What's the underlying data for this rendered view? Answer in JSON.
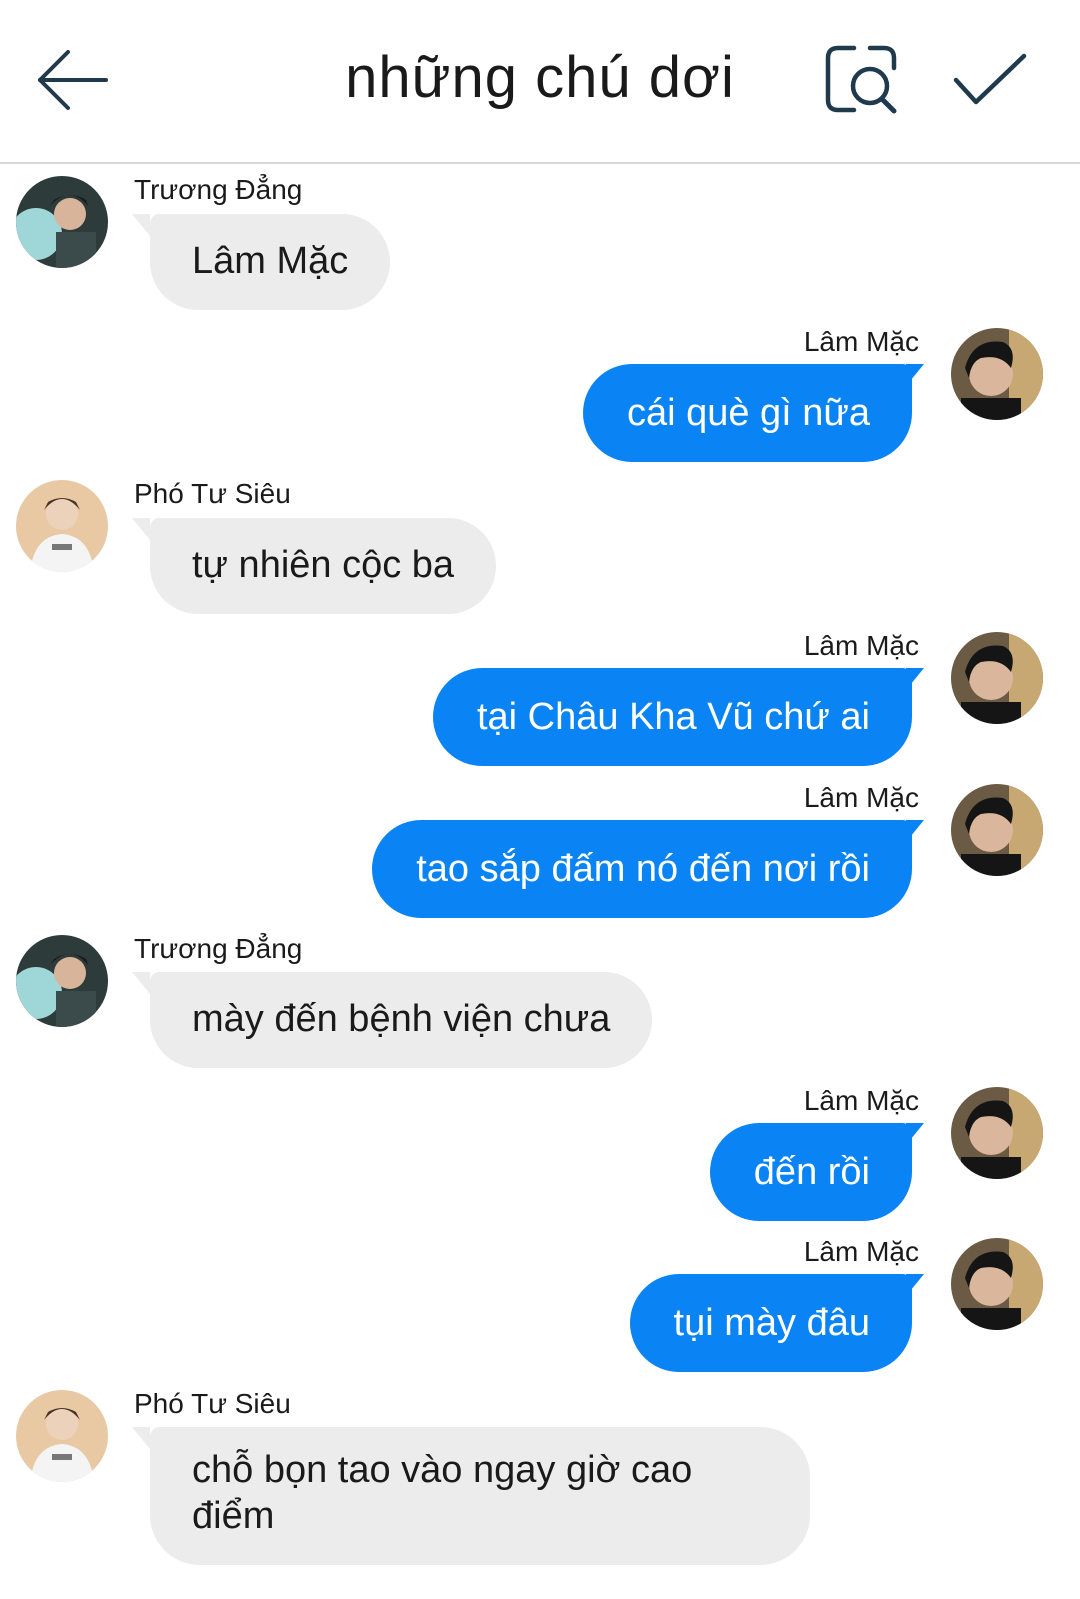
{
  "header": {
    "title": "những chú dơi",
    "back_icon": "arrow-left-icon",
    "search_icon": "search-chat-icon",
    "confirm_icon": "checkmark-icon"
  },
  "colors": {
    "outgoing_bubble": "#0a84f4",
    "incoming_bubble": "#ececec"
  },
  "messages": [
    {
      "sender": "Trương Đẳng",
      "text": "Lâm Mặc",
      "direction": "in"
    },
    {
      "sender": "Lâm Mặc",
      "text": "cái què gì nữa",
      "direction": "out"
    },
    {
      "sender": "Phó Tư Siêu",
      "text": "tự nhiên cộc ba",
      "direction": "in"
    },
    {
      "sender": "Lâm Mặc",
      "text": "tại Châu Kha Vũ chứ ai",
      "direction": "out"
    },
    {
      "sender": "Lâm Mặc",
      "text": "tao sắp đấm nó đến nơi rồi",
      "direction": "out"
    },
    {
      "sender": "Trương Đẳng",
      "text": "mày đến bệnh viện chưa",
      "direction": "in"
    },
    {
      "sender": "Lâm Mặc",
      "text": "đến rồi",
      "direction": "out"
    },
    {
      "sender": "Lâm Mặc",
      "text": "tụi mày đâu",
      "direction": "out"
    },
    {
      "sender": "Phó Tư Siêu",
      "text": "chỗ bọn tao vào ngay giờ cao điểm",
      "direction": "in"
    }
  ]
}
